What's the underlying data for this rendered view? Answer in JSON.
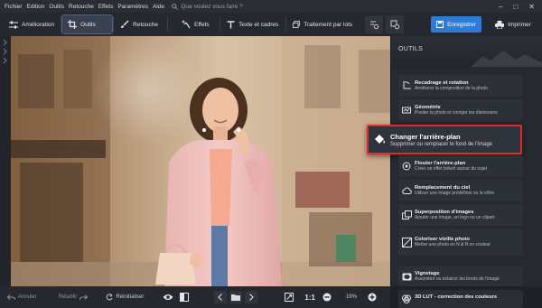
{
  "menu": {
    "items": [
      "Fichier",
      "Edition",
      "Outils",
      "Retouche",
      "Effets",
      "Paramètres",
      "Aide"
    ],
    "search_placeholder": "Que voulez vous faire ?"
  },
  "toolbar": {
    "tabs": [
      {
        "label": "Amélioration",
        "icon": "sliders-icon"
      },
      {
        "label": "Outils",
        "icon": "crop-icon",
        "active": true
      },
      {
        "label": "Retouche",
        "icon": "brush-icon"
      },
      {
        "label": "Effets",
        "icon": "sparkle-icon"
      },
      {
        "label": "Texte et cadres",
        "icon": "text-icon"
      },
      {
        "label": "Traitement par lots",
        "icon": "batch-icon"
      }
    ],
    "save_label": "Enregistrer",
    "print_label": "Imprimer"
  },
  "panel": {
    "title": "OUTILS",
    "tools": [
      {
        "title": "Recadrage et rotation",
        "desc": "Améliorer la composition de la photo",
        "icon": "crop-rotate-icon"
      },
      {
        "title": "Géométrie",
        "desc": "Pivoter la photo et corriger les distorsions",
        "icon": "geometry-icon"
      },
      {
        "title": "Changer l'arrière-plan",
        "desc": "Supprimer ou remplacer le fond de l'image",
        "icon": "paint-bucket-icon"
      },
      {
        "title": "Flouter l'arrière-plan",
        "desc": "Créer un effet bokeh autour du sujet",
        "icon": "blur-icon"
      },
      {
        "title": "Remplacement du ciel",
        "desc": "Utiliser une image prédéfinie ou la vôtre",
        "icon": "cloud-icon"
      },
      {
        "title": "Superposition d'images",
        "desc": "Ajouter une image, un logo ou un clipart",
        "icon": "overlay-icon"
      },
      {
        "title": "Coloriser vieille photo",
        "desc": "Mettre une photo en N & B en couleur",
        "icon": "colorize-icon"
      },
      {
        "title": "Vignetage",
        "desc": "Assombrir ou éclaircir les bords de l'image",
        "icon": "vignette-icon"
      },
      {
        "title": "3D LUT - correction des couleurs",
        "desc": "",
        "icon": "lut-icon"
      }
    ]
  },
  "bottom": {
    "undo_label": "Annuler",
    "redo_label": "Rétablir",
    "reset_label": "Réinitialiser",
    "ratio_label": "1:1",
    "zoom_value": "19%"
  },
  "colors": {
    "accent": "#2f7bd8",
    "highlight": "#e12b2b"
  }
}
